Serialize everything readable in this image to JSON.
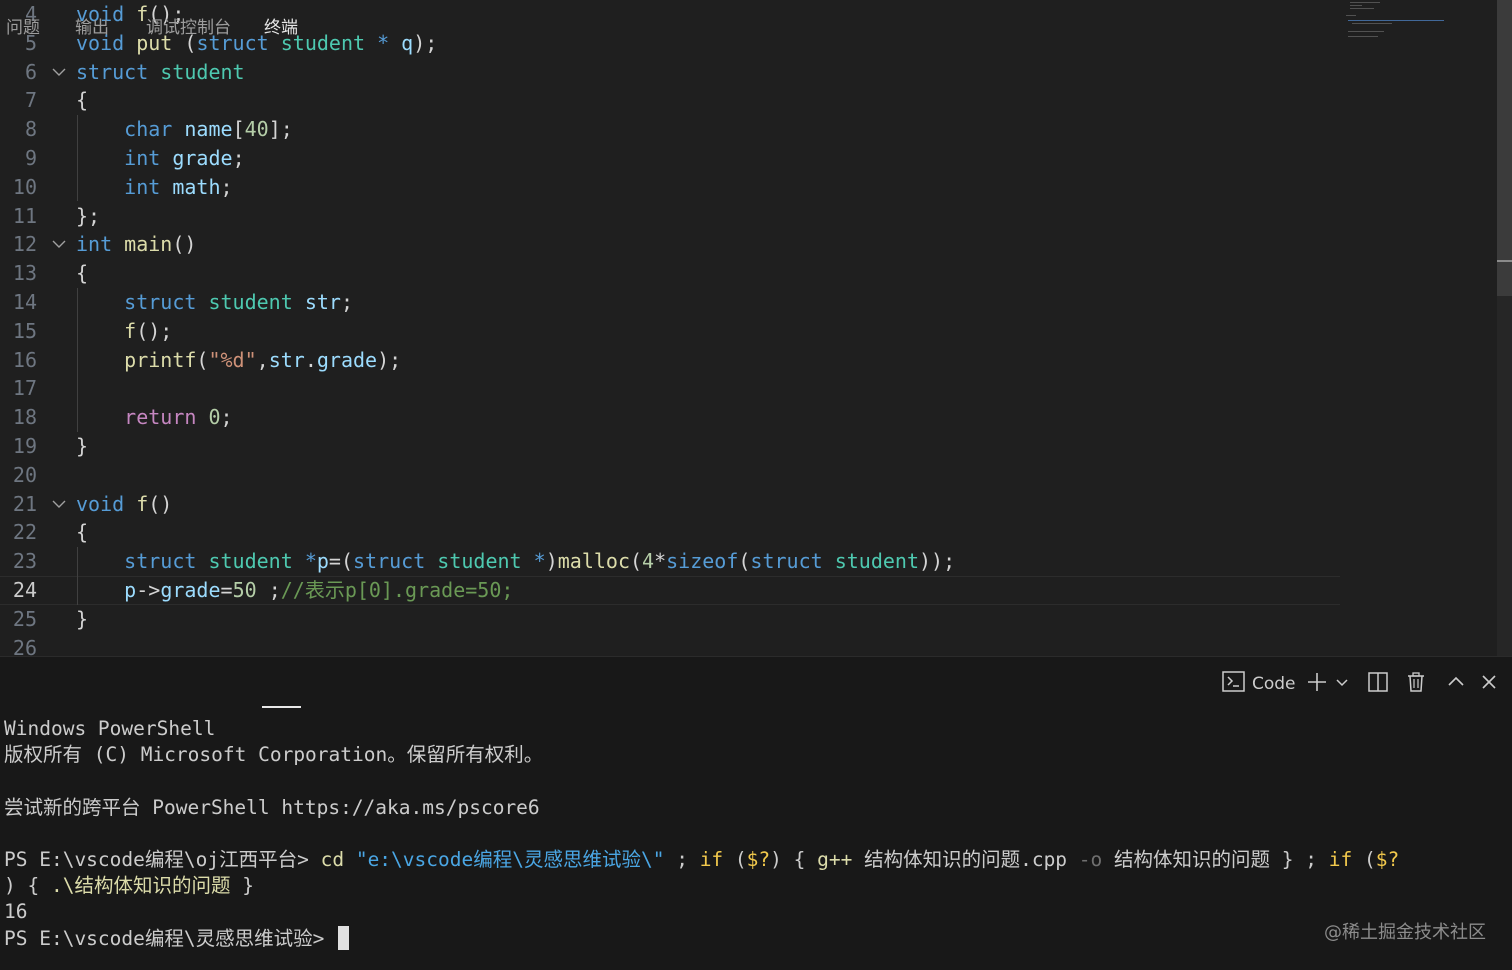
{
  "editor": {
    "lines": [
      {
        "num": "4",
        "fold": false,
        "tokens": [
          {
            "t": "kw",
            "v": "void"
          },
          {
            "t": "pl",
            "v": " "
          },
          {
            "t": "fn",
            "v": "f"
          },
          {
            "t": "pl",
            "v": "();"
          }
        ]
      },
      {
        "num": "5",
        "fold": false,
        "tokens": [
          {
            "t": "kw",
            "v": "void"
          },
          {
            "t": "pl",
            "v": " "
          },
          {
            "t": "fn",
            "v": "put"
          },
          {
            "t": "pl",
            "v": " ("
          },
          {
            "t": "kw",
            "v": "struct"
          },
          {
            "t": "pl",
            "v": " "
          },
          {
            "t": "type",
            "v": "student"
          },
          {
            "t": "pl",
            "v": " "
          },
          {
            "t": "kw",
            "v": "*"
          },
          {
            "t": "pl",
            "v": " "
          },
          {
            "t": "var",
            "v": "q"
          },
          {
            "t": "pl",
            "v": ");"
          }
        ]
      },
      {
        "num": "6",
        "fold": true,
        "tokens": [
          {
            "t": "kw",
            "v": "struct"
          },
          {
            "t": "pl",
            "v": " "
          },
          {
            "t": "type",
            "v": "student"
          }
        ]
      },
      {
        "num": "7",
        "fold": false,
        "tokens": [
          {
            "t": "pl",
            "v": "{"
          }
        ]
      },
      {
        "num": "8",
        "fold": false,
        "tokens": [
          {
            "t": "pl",
            "v": "    "
          },
          {
            "t": "kw",
            "v": "char"
          },
          {
            "t": "pl",
            "v": " "
          },
          {
            "t": "var",
            "v": "name"
          },
          {
            "t": "pl",
            "v": "["
          },
          {
            "t": "num",
            "v": "40"
          },
          {
            "t": "pl",
            "v": "];"
          }
        ]
      },
      {
        "num": "9",
        "fold": false,
        "tokens": [
          {
            "t": "pl",
            "v": "    "
          },
          {
            "t": "kw",
            "v": "int"
          },
          {
            "t": "pl",
            "v": " "
          },
          {
            "t": "var",
            "v": "grade"
          },
          {
            "t": "pl",
            "v": ";"
          }
        ]
      },
      {
        "num": "10",
        "fold": false,
        "tokens": [
          {
            "t": "pl",
            "v": "    "
          },
          {
            "t": "kw",
            "v": "int"
          },
          {
            "t": "pl",
            "v": " "
          },
          {
            "t": "var",
            "v": "math"
          },
          {
            "t": "pl",
            "v": ";"
          }
        ]
      },
      {
        "num": "11",
        "fold": false,
        "tokens": [
          {
            "t": "pl",
            "v": "};"
          }
        ]
      },
      {
        "num": "12",
        "fold": true,
        "tokens": [
          {
            "t": "kw",
            "v": "int"
          },
          {
            "t": "pl",
            "v": " "
          },
          {
            "t": "fn",
            "v": "main"
          },
          {
            "t": "pl",
            "v": "()"
          }
        ]
      },
      {
        "num": "13",
        "fold": false,
        "tokens": [
          {
            "t": "pl",
            "v": "{"
          }
        ]
      },
      {
        "num": "14",
        "fold": false,
        "tokens": [
          {
            "t": "pl",
            "v": "    "
          },
          {
            "t": "kw",
            "v": "struct"
          },
          {
            "t": "pl",
            "v": " "
          },
          {
            "t": "type",
            "v": "student"
          },
          {
            "t": "pl",
            "v": " "
          },
          {
            "t": "var",
            "v": "str"
          },
          {
            "t": "pl",
            "v": ";"
          }
        ]
      },
      {
        "num": "15",
        "fold": false,
        "tokens": [
          {
            "t": "pl",
            "v": "    "
          },
          {
            "t": "fn",
            "v": "f"
          },
          {
            "t": "pl",
            "v": "();"
          }
        ]
      },
      {
        "num": "16",
        "fold": false,
        "tokens": [
          {
            "t": "pl",
            "v": "    "
          },
          {
            "t": "fn",
            "v": "printf"
          },
          {
            "t": "pl",
            "v": "("
          },
          {
            "t": "str",
            "v": "\"%d\""
          },
          {
            "t": "pl",
            "v": ","
          },
          {
            "t": "var",
            "v": "str"
          },
          {
            "t": "pl",
            "v": "."
          },
          {
            "t": "var",
            "v": "grade"
          },
          {
            "t": "pl",
            "v": ");"
          }
        ]
      },
      {
        "num": "17",
        "fold": false,
        "tokens": []
      },
      {
        "num": "18",
        "fold": false,
        "tokens": [
          {
            "t": "pl",
            "v": "    "
          },
          {
            "t": "ctl",
            "v": "return"
          },
          {
            "t": "pl",
            "v": " "
          },
          {
            "t": "num",
            "v": "0"
          },
          {
            "t": "pl",
            "v": ";"
          }
        ]
      },
      {
        "num": "19",
        "fold": false,
        "tokens": [
          {
            "t": "pl",
            "v": "}"
          }
        ]
      },
      {
        "num": "20",
        "fold": false,
        "tokens": []
      },
      {
        "num": "21",
        "fold": true,
        "tokens": [
          {
            "t": "kw",
            "v": "void"
          },
          {
            "t": "pl",
            "v": " "
          },
          {
            "t": "fn",
            "v": "f"
          },
          {
            "t": "pl",
            "v": "()"
          }
        ]
      },
      {
        "num": "22",
        "fold": false,
        "tokens": [
          {
            "t": "pl",
            "v": "{"
          }
        ]
      },
      {
        "num": "23",
        "fold": false,
        "tokens": [
          {
            "t": "pl",
            "v": "    "
          },
          {
            "t": "kw",
            "v": "struct"
          },
          {
            "t": "pl",
            "v": " "
          },
          {
            "t": "type",
            "v": "student"
          },
          {
            "t": "pl",
            "v": " "
          },
          {
            "t": "kw",
            "v": "*"
          },
          {
            "t": "var",
            "v": "p"
          },
          {
            "t": "pl",
            "v": "=("
          },
          {
            "t": "kw",
            "v": "struct"
          },
          {
            "t": "pl",
            "v": " "
          },
          {
            "t": "type",
            "v": "student"
          },
          {
            "t": "pl",
            "v": " "
          },
          {
            "t": "kw",
            "v": "*"
          },
          {
            "t": "pl",
            "v": ")"
          },
          {
            "t": "fn",
            "v": "malloc"
          },
          {
            "t": "pl",
            "v": "("
          },
          {
            "t": "num",
            "v": "4"
          },
          {
            "t": "pl",
            "v": "*"
          },
          {
            "t": "kw",
            "v": "sizeof"
          },
          {
            "t": "pl",
            "v": "("
          },
          {
            "t": "kw",
            "v": "struct"
          },
          {
            "t": "pl",
            "v": " "
          },
          {
            "t": "type",
            "v": "student"
          },
          {
            "t": "pl",
            "v": "));"
          }
        ]
      },
      {
        "num": "24",
        "fold": false,
        "active": true,
        "tokens": [
          {
            "t": "pl",
            "v": "    "
          },
          {
            "t": "var",
            "v": "p"
          },
          {
            "t": "pl",
            "v": "->"
          },
          {
            "t": "var",
            "v": "grade"
          },
          {
            "t": "pl",
            "v": "="
          },
          {
            "t": "num",
            "v": "50"
          },
          {
            "t": "pl",
            "v": " ;"
          },
          {
            "t": "com",
            "v": "//表示p[0].grade=50;"
          }
        ]
      },
      {
        "num": "25",
        "fold": false,
        "tokens": [
          {
            "t": "pl",
            "v": "}"
          }
        ]
      },
      {
        "num": "26",
        "fold": false,
        "tokens": []
      }
    ]
  },
  "panel": {
    "tabs": [
      {
        "label": "问题",
        "active": false
      },
      {
        "label": "输出",
        "active": false
      },
      {
        "label": "调试控制台",
        "active": false
      },
      {
        "label": "终端",
        "active": true
      }
    ],
    "toolbar": {
      "terminal_label": "Code"
    },
    "icons": [
      "terminal-icon",
      "plus-icon",
      "chevron-down-icon",
      "split-icon",
      "trash-icon",
      "chevron-up-icon",
      "close-icon"
    ]
  },
  "terminal": {
    "lines": [
      [
        {
          "c": "",
          "v": "Windows PowerShell"
        }
      ],
      [
        {
          "c": "",
          "v": "版权所有 (C) Microsoft Corporation。保留所有权利。"
        }
      ],
      [
        {
          "c": "",
          "v": ""
        }
      ],
      [
        {
          "c": "",
          "v": "尝试新的跨平台 PowerShell https://aka.ms/pscore6"
        }
      ],
      [
        {
          "c": "",
          "v": ""
        }
      ],
      [
        {
          "c": "",
          "v": "PS E:\\vscode编程\\oj江西平台> "
        },
        {
          "c": "cmd",
          "v": "cd"
        },
        {
          "c": "",
          "v": " "
        },
        {
          "c": "str",
          "v": "\"e:\\vscode编程\\灵感思维试验\\\""
        },
        {
          "c": "",
          "v": " ; "
        },
        {
          "c": "kw",
          "v": "if"
        },
        {
          "c": "",
          "v": " ("
        },
        {
          "c": "kw",
          "v": "$?"
        },
        {
          "c": "",
          "v": ") { "
        },
        {
          "c": "cmd",
          "v": "g++"
        },
        {
          "c": "",
          "v": " 结构体知识的问题.cpp "
        },
        {
          "c": "dim",
          "v": "-o"
        },
        {
          "c": "",
          "v": " 结构体知识的问题 } ; "
        },
        {
          "c": "kw",
          "v": "if"
        },
        {
          "c": "",
          "v": " ("
        },
        {
          "c": "kw",
          "v": "$?"
        }
      ],
      [
        {
          "c": "",
          "v": ") { "
        },
        {
          "c": "cmd",
          "v": ".\\结构体知识的问题"
        },
        {
          "c": "",
          "v": " }"
        }
      ],
      [
        {
          "c": "",
          "v": "16"
        }
      ],
      [
        {
          "c": "",
          "v": "PS E:\\vscode编程\\灵感思维试验> "
        }
      ]
    ]
  },
  "watermark": "@稀土掘金技术社区"
}
